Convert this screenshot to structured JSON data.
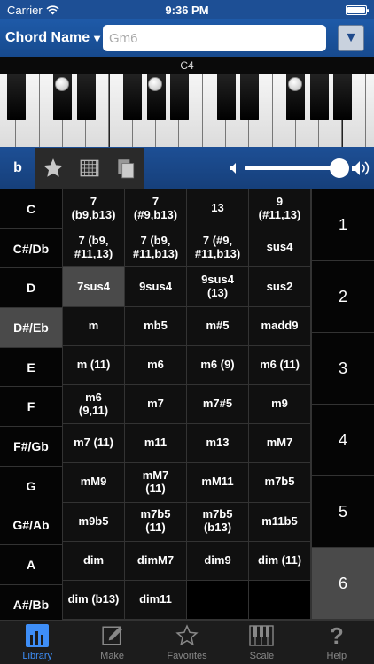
{
  "status": {
    "carrier": "Carrier",
    "time": "9:36 PM"
  },
  "header": {
    "chord_name_label": "Chord Name",
    "chord_name_arrow": "▼",
    "input_placeholder": "Gm6",
    "dropdown_glyph": "▼"
  },
  "keyboard": {
    "octave_label": "C4"
  },
  "toolbar": {
    "flat_label": "b"
  },
  "notes": [
    "C",
    "C#/Db",
    "D",
    "D#/Eb",
    "E",
    "F",
    "F#/Gb",
    "G",
    "G#/Ab",
    "A",
    "A#/Bb"
  ],
  "selected_note": "D#/Eb",
  "chords": [
    "7\n(b9,b13)",
    "7\n(#9,b13)",
    "13",
    "9\n(#11,13)",
    "7 (b9,\n#11,13)",
    "7 (b9,\n#11,b13)",
    "7 (#9,\n#11,b13)",
    "sus4",
    "7sus4",
    "9sus4",
    "9sus4\n(13)",
    "sus2",
    "m",
    "mb5",
    "m#5",
    "madd9",
    "m (11)",
    "m6",
    "m6 (9)",
    "m6 (11)",
    "m6\n(9,11)",
    "m7",
    "m7#5",
    "m9",
    "m7 (11)",
    "m11",
    "m13",
    "mM7",
    "mM9",
    "mM7\n(11)",
    "mM11",
    "m7b5",
    "m9b5",
    "m7b5\n(11)",
    "m7b5\n(b13)",
    "m11b5",
    "dim",
    "dimM7",
    "dim9",
    "dim (11)",
    "dim (b13)",
    "dim11",
    "",
    ""
  ],
  "selected_chord": "7sus4",
  "numbers": [
    "1",
    "2",
    "3",
    "4",
    "5",
    "6"
  ],
  "selected_number": "6",
  "tabs": [
    {
      "label": "Library",
      "icon": "library-icon",
      "active": true
    },
    {
      "label": "Make",
      "icon": "pencil-icon",
      "active": false
    },
    {
      "label": "Favorites",
      "icon": "star-icon",
      "active": false
    },
    {
      "label": "Scale",
      "icon": "scale-keys-icon",
      "active": false
    },
    {
      "label": "Help",
      "icon": "question-icon",
      "active": false
    }
  ],
  "volume": 0.92,
  "colors": {
    "header_blue": "#1e5aa8",
    "active_tab": "#3e8ef7",
    "selected_cell": "#4a4a4a"
  }
}
